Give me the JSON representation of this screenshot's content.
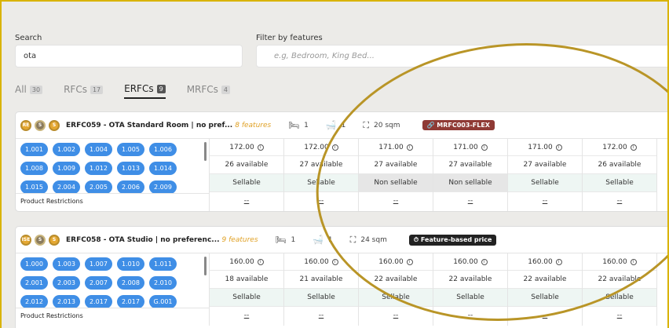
{
  "search": {
    "label": "Search",
    "value": "ota"
  },
  "filter": {
    "label": "Filter by features",
    "placeholder": "e.g, Bedroom, King Bed..."
  },
  "tabs": [
    {
      "label": "All",
      "count": "30"
    },
    {
      "label": "RFCs",
      "count": "17"
    },
    {
      "label": "ERFCs",
      "count": "9"
    },
    {
      "label": "MRFCs",
      "count": "4"
    }
  ],
  "cards": [
    {
      "icons": [
        "RE",
        "S",
        "S"
      ],
      "title": "ERFC059 - OTA Standard Room | no pref...",
      "features": "8 features",
      "beds": "1",
      "baths": "1",
      "area": "20 sqm",
      "pill": "MRFC003-FLEX",
      "chips": [
        "1.001",
        "1.002",
        "1.004",
        "1.005",
        "1.006",
        "1.008",
        "1.009",
        "1.012",
        "1.013",
        "1.014",
        "1.015",
        "2.004",
        "2.005",
        "2.006",
        "2.009"
      ],
      "restrictions": "Product Restrictions",
      "days": [
        {
          "price": "172.00",
          "avail": "26 available",
          "status": "Sellable",
          "restr": "--"
        },
        {
          "price": "172.00",
          "avail": "27 available",
          "status": "Sellable",
          "restr": "--"
        },
        {
          "price": "171.00",
          "avail": "27 available",
          "status": "Non sellable",
          "restr": "--"
        },
        {
          "price": "171.00",
          "avail": "27 available",
          "status": "Non sellable",
          "restr": "--"
        },
        {
          "price": "171.00",
          "avail": "27 available",
          "status": "Sellable",
          "restr": "--"
        },
        {
          "price": "172.00",
          "avail": "26 available",
          "status": "Sellable",
          "restr": "--"
        }
      ]
    },
    {
      "icons": [
        "ISE",
        "S",
        "S"
      ],
      "title": "ERFC058 - OTA Studio | no preferenc...",
      "features": "9 features",
      "beds": "1",
      "baths": "1",
      "area": "24 sqm",
      "pill": "Feature-based price",
      "chips": [
        "1.000",
        "1.003",
        "1.007",
        "1.010",
        "1.011",
        "2.001",
        "2.003",
        "2.007",
        "2.008",
        "2.010",
        "2.012",
        "2.013",
        "2.017",
        "2.017",
        "G.001"
      ],
      "restrictions": "Product Restrictions",
      "days": [
        {
          "price": "160.00",
          "avail": "18 available",
          "status": "Sellable",
          "restr": "--"
        },
        {
          "price": "160.00",
          "avail": "21 available",
          "status": "Sellable",
          "restr": "--"
        },
        {
          "price": "160.00",
          "avail": "22 available",
          "status": "Sellable",
          "restr": "--"
        },
        {
          "price": "160.00",
          "avail": "22 available",
          "status": "Sellable",
          "restr": "--"
        },
        {
          "price": "160.00",
          "avail": "22 available",
          "status": "Sellable",
          "restr": "--"
        },
        {
          "price": "160.00",
          "avail": "22 available",
          "status": "Sellable",
          "restr": "--"
        }
      ]
    }
  ]
}
